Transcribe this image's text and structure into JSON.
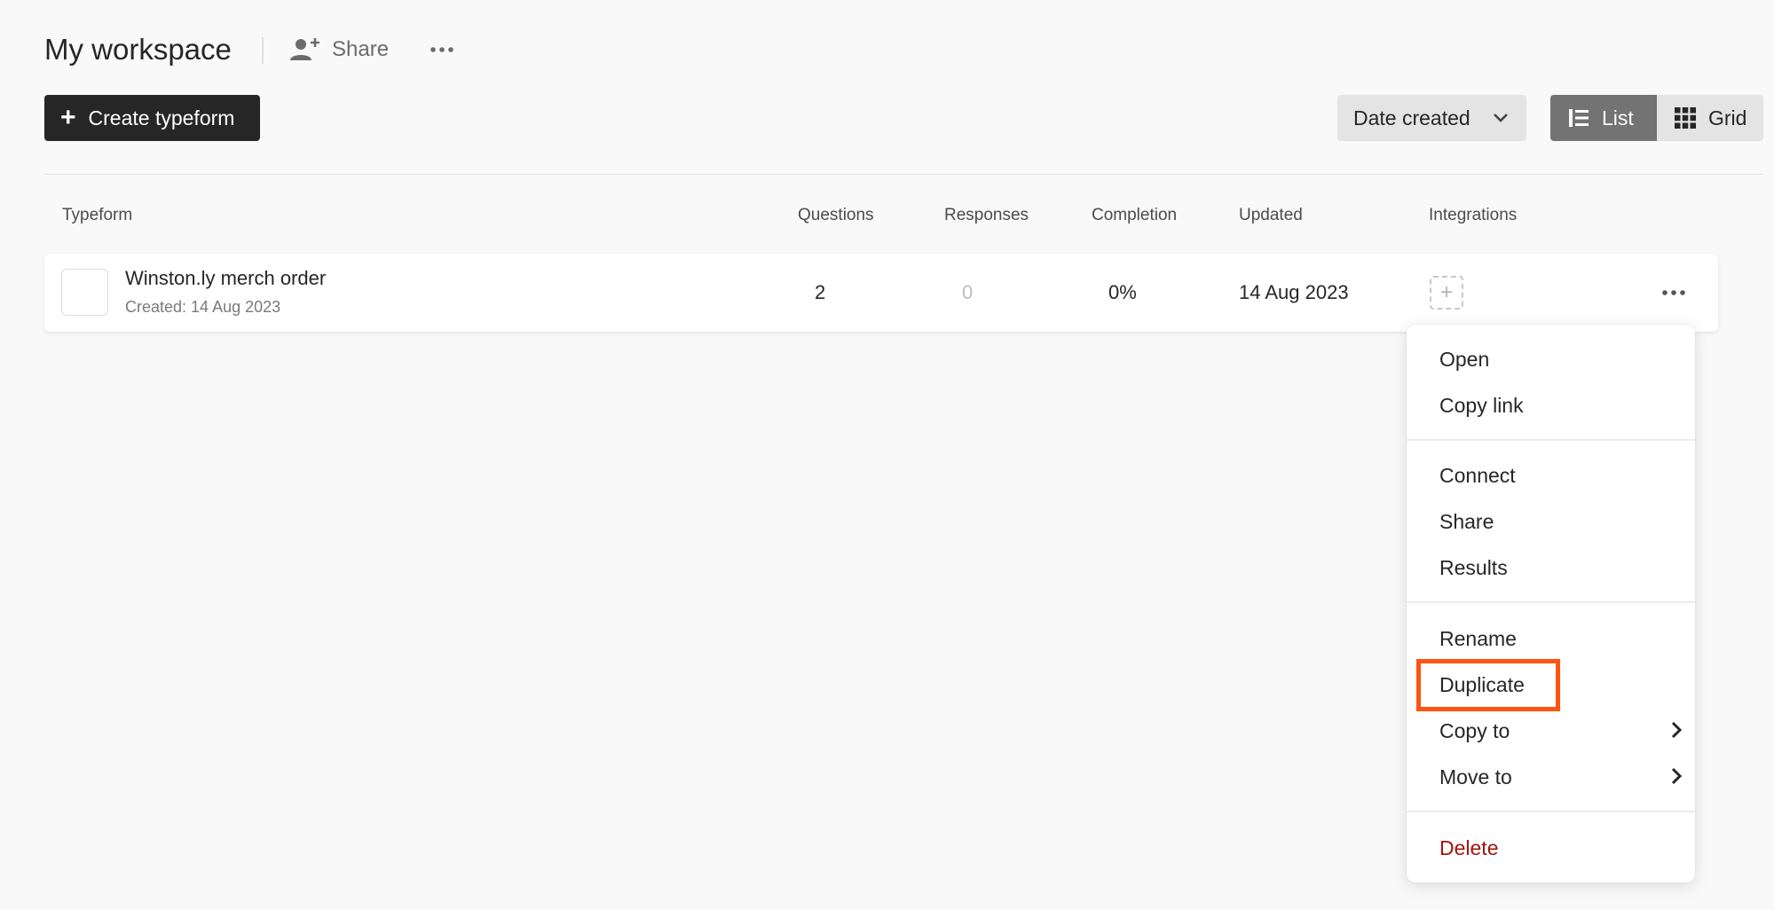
{
  "header": {
    "title": "My workspace",
    "share_label": "Share"
  },
  "toolbar": {
    "create_label": "Create typeform",
    "sort_label": "Date created",
    "view_list_label": "List",
    "view_grid_label": "Grid"
  },
  "table": {
    "columns": {
      "typeform": "Typeform",
      "questions": "Questions",
      "responses": "Responses",
      "completion": "Completion",
      "updated": "Updated",
      "integrations": "Integrations"
    },
    "rows": [
      {
        "title": "Winston.ly merch order",
        "created": "Created: 14 Aug 2023",
        "questions": "2",
        "responses": "0",
        "completion": "0%",
        "updated": "14 Aug 2023"
      }
    ]
  },
  "context_menu": {
    "items": {
      "open": "Open",
      "copy_link": "Copy link",
      "connect": "Connect",
      "share": "Share",
      "results": "Results",
      "rename": "Rename",
      "duplicate": "Duplicate",
      "copy_to": "Copy to",
      "move_to": "Move to",
      "delete": "Delete"
    },
    "highlighted_item": "Duplicate"
  },
  "colors": {
    "primary_button": "#262627",
    "highlight": "#ff5311",
    "danger": "#a3140f",
    "active_toggle": "#737373"
  }
}
